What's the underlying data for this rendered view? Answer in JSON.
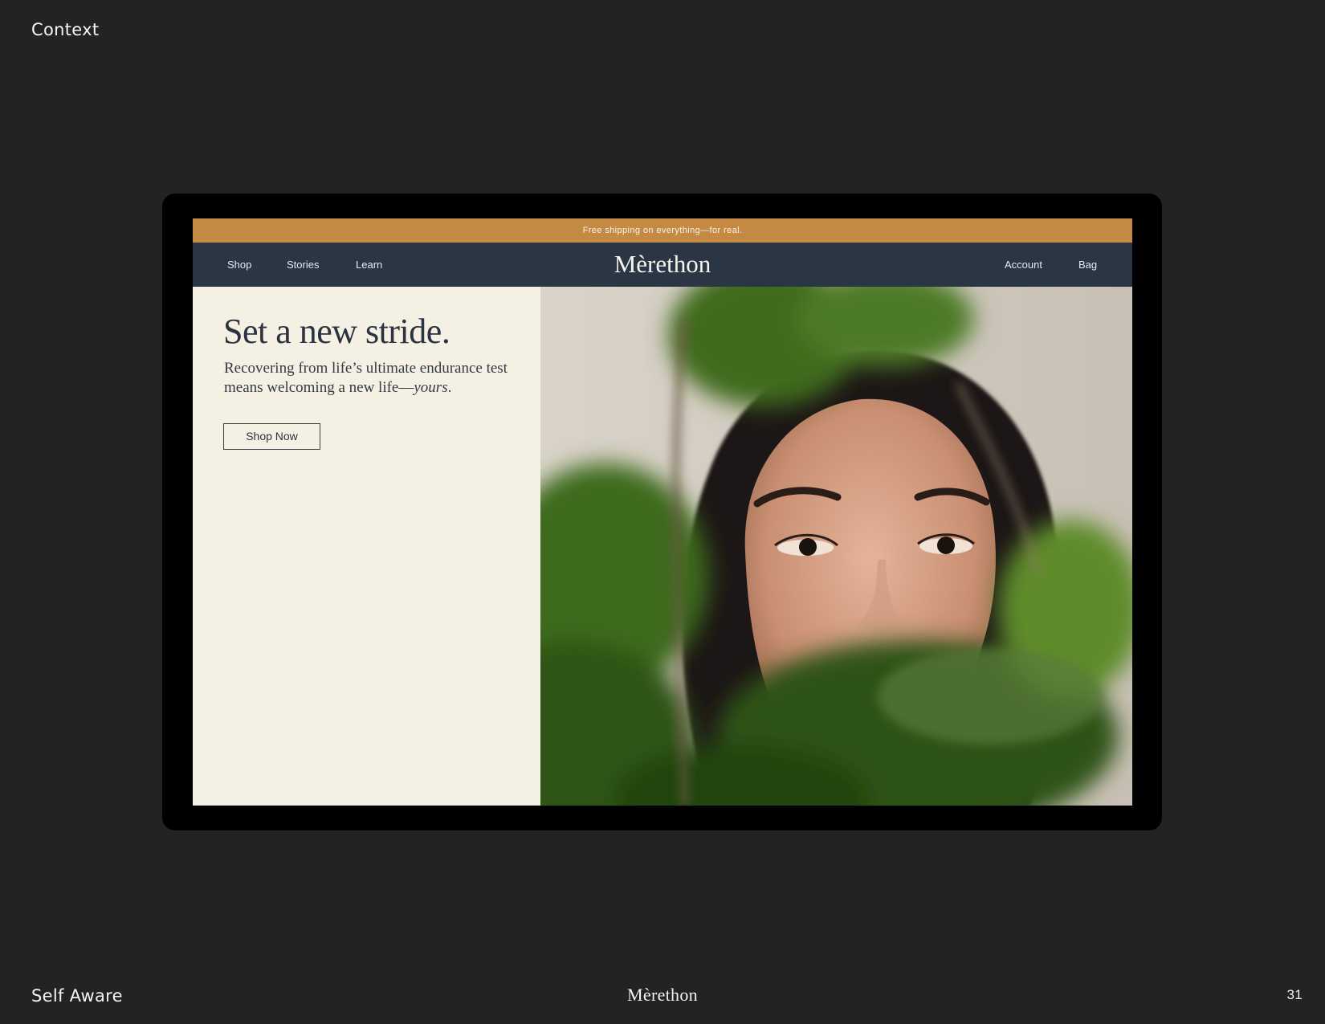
{
  "slide": {
    "section_title": "Context",
    "footer_left": "Self Aware",
    "footer_center": "Mèrethon",
    "page_number": "31"
  },
  "site": {
    "promo_text": "Free shipping on everything—for real.",
    "nav_left": [
      "Shop",
      "Stories",
      "Learn"
    ],
    "brand": "Mèrethon",
    "nav_right": [
      "Account",
      "Bag"
    ]
  },
  "hero": {
    "title": "Set a new stride.",
    "copy_lead": "Recovering from life’s ultimate endurance test means welcoming a new life—",
    "copy_italic": "yours",
    "copy_end": ".",
    "button": "Shop Now"
  },
  "colors": {
    "slide_bg": "#232323",
    "promo_bar": "#c48942",
    "nav_bar": "#2b3644",
    "hero_bg": "#f4f0e4",
    "text_dark": "#2b3340"
  }
}
